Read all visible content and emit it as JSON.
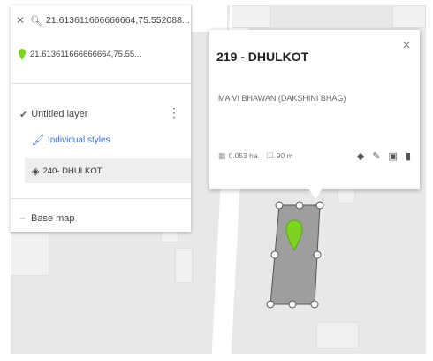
{
  "search": {
    "query": "21.613611666666664,75.552088..."
  },
  "result": {
    "coords": "21.613611666666664,75.55..."
  },
  "layer": {
    "name": "Untitled layer",
    "styles_label": "Individual styles",
    "feature_label": "240- DHULKOT"
  },
  "basemap": {
    "label": "Base map"
  },
  "popup": {
    "title": "219 - DHULKOT",
    "description": "MA VI BHAWAN (DAKSHINI BHAG)",
    "area": "0.053 ha",
    "perimeter": "90 m"
  },
  "colors": {
    "polygon_fill": "#9e9e9e",
    "pin": "#7ed321",
    "link": "#3b6fd6"
  },
  "icons": [
    "close-icon",
    "search-icon",
    "pin-icon",
    "checkbox-icon",
    "more-vert-icon",
    "paint-icon",
    "tag-icon",
    "minus-icon",
    "fill-icon",
    "edit-icon",
    "camera-icon",
    "delete-icon"
  ]
}
